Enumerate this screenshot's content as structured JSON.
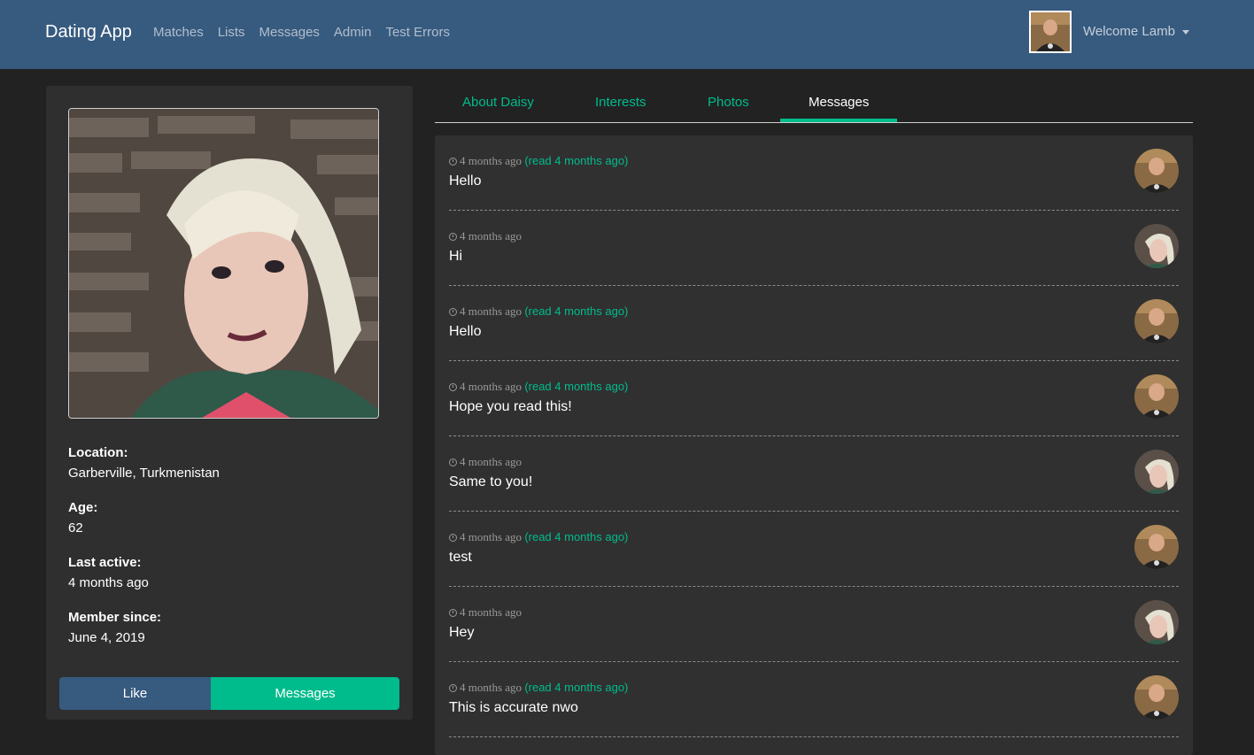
{
  "nav": {
    "brand": "Dating App",
    "links": [
      "Matches",
      "Lists",
      "Messages",
      "Admin",
      "Test Errors"
    ],
    "welcome": "Welcome Lamb"
  },
  "profile": {
    "location_label": "Location:",
    "location": "Garberville, Turkmenistan",
    "age_label": "Age:",
    "age": "62",
    "last_active_label": "Last active:",
    "last_active": "4 months ago",
    "member_since_label": "Member since:",
    "member_since": "June 4, 2019",
    "like_label": "Like",
    "messages_label": "Messages"
  },
  "tabs": [
    "About Daisy",
    "Interests",
    "Photos",
    "Messages"
  ],
  "active_tab": "Messages",
  "messages": [
    {
      "time": "4 months ago",
      "read": "(read 4 months ago)",
      "text": "Hello",
      "sender": "lamb"
    },
    {
      "time": "4 months ago",
      "read": "",
      "text": "Hi",
      "sender": "daisy"
    },
    {
      "time": "4 months ago",
      "read": "(read 4 months ago)",
      "text": "Hello",
      "sender": "lamb"
    },
    {
      "time": "4 months ago",
      "read": "(read 4 months ago)",
      "text": "Hope you read this!",
      "sender": "lamb"
    },
    {
      "time": "4 months ago",
      "read": "",
      "text": "Same to you!",
      "sender": "daisy"
    },
    {
      "time": "4 months ago",
      "read": "(read 4 months ago)",
      "text": "test",
      "sender": "lamb"
    },
    {
      "time": "4 months ago",
      "read": "",
      "text": "Hey",
      "sender": "daisy"
    },
    {
      "time": "4 months ago",
      "read": "(read 4 months ago)",
      "text": "This is accurate nwo",
      "sender": "lamb"
    }
  ],
  "colors": {
    "primary": "#375a7f",
    "success": "#00bc8c",
    "background": "#222222",
    "card": "#303030"
  }
}
